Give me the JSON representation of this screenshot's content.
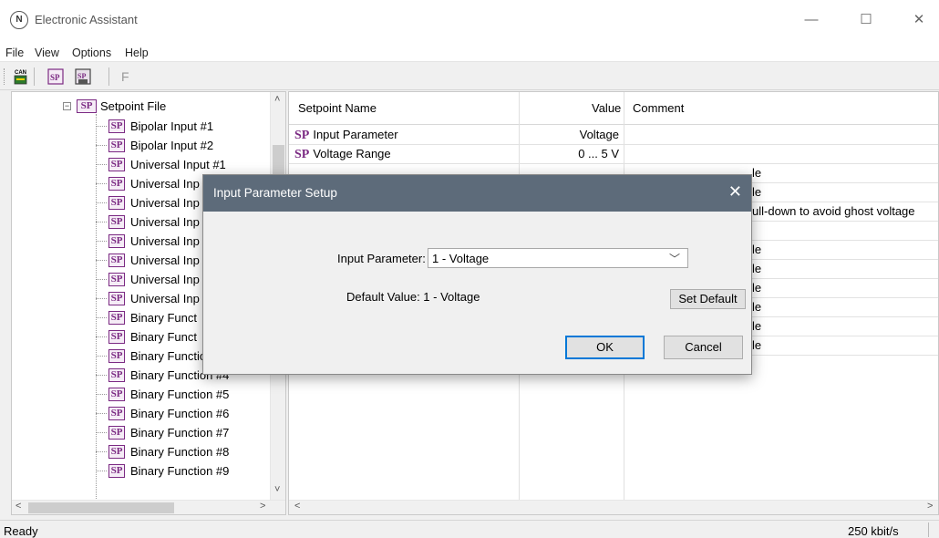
{
  "window": {
    "title": "Electronic Assistant",
    "app_icon": "N",
    "controls": {
      "minimize": "—",
      "maximize": "☐",
      "close": "✕"
    }
  },
  "menu": [
    "File",
    "View",
    "Options",
    "Help"
  ],
  "toolbar": {
    "f_label": "F"
  },
  "tree": {
    "root_label": "Setpoint File",
    "root_icon_text": "SP",
    "item_icon_text": "SP",
    "items": [
      "Bipolar Input #1",
      "Bipolar Input #2",
      "Universal Input #1",
      "Universal Inp",
      "Universal Inp",
      "Universal Inp",
      "Universal Inp",
      "Universal Inp",
      "Universal Inp",
      "Universal Inp",
      "Binary Funct",
      "Binary Funct",
      "Binary Function #3",
      "Binary Function #4",
      "Binary Function #5",
      "Binary Function #6",
      "Binary Function #7",
      "Binary Function #8",
      "Binary Function #9"
    ]
  },
  "grid": {
    "headers": {
      "name": "Setpoint Name",
      "value": "Value",
      "comment": "Comment"
    },
    "sp_prefix": "SP",
    "rows": [
      {
        "name": "Input Parameter",
        "value": "Voltage",
        "comment": ""
      },
      {
        "name": "Voltage Range",
        "value": "0 ... 5 V",
        "comment": ""
      },
      {
        "name": "",
        "value": "",
        "comment": "le"
      },
      {
        "name": "",
        "value": "",
        "comment": "le"
      },
      {
        "name": "",
        "value": "",
        "comment": "ull-down to avoid ghost voltage"
      },
      {
        "name": "",
        "value": "",
        "comment": ""
      },
      {
        "name": "",
        "value": "",
        "comment": "le"
      },
      {
        "name": "",
        "value": "",
        "comment": "le"
      },
      {
        "name": "",
        "value": "",
        "comment": "le"
      },
      {
        "name": "",
        "value": "",
        "comment": "le"
      },
      {
        "name": "",
        "value": "",
        "comment": "le"
      },
      {
        "name": "",
        "value": "",
        "comment": "le"
      }
    ]
  },
  "status": {
    "left": "Ready",
    "right": "250 kbit/s"
  },
  "dialog": {
    "title": "Input Parameter Setup",
    "close": "✕",
    "input_label": "Input Parameter:",
    "input_value": "1 - Voltage",
    "default_label": "Default Value: 1 - Voltage",
    "set_default": "Set Default",
    "ok": "OK",
    "cancel": "Cancel"
  },
  "colors": {
    "sp_accent": "#7b2a83",
    "dialog_title_bg": "#5d6b7a"
  }
}
